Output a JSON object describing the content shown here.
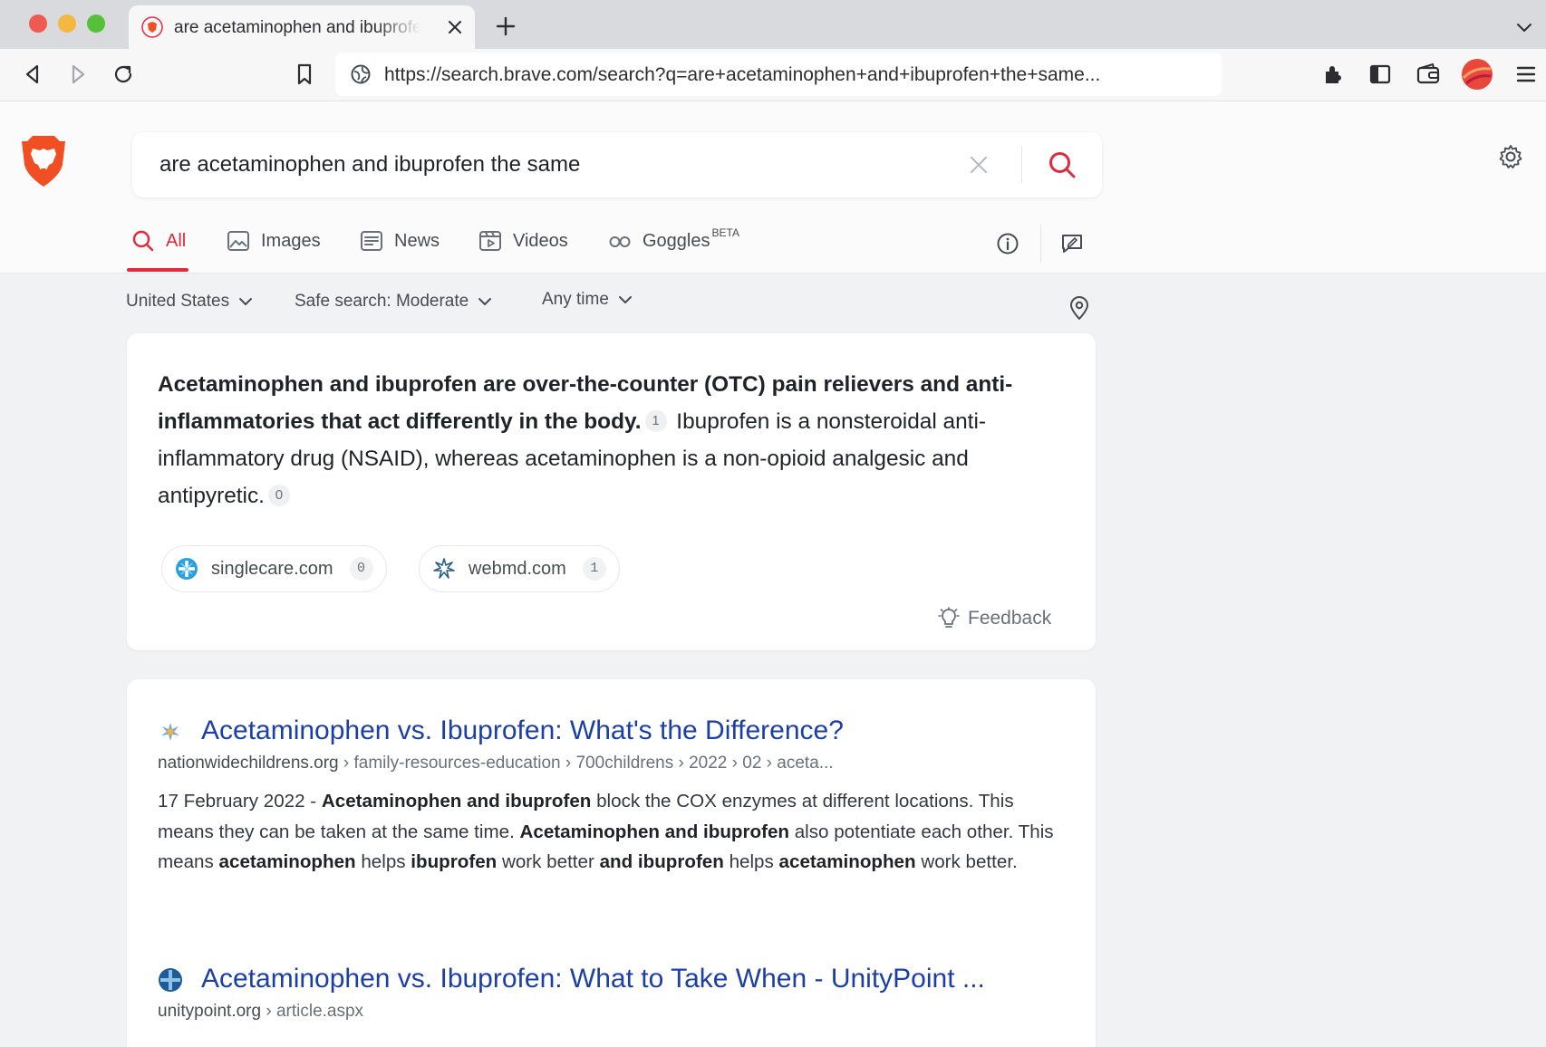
{
  "browser": {
    "tab_title": "are acetaminophen and ibuprofen the same - Brave Search",
    "url": "https://search.brave.com/search?q=are+acetaminophen+and+ibuprofen+the+same..."
  },
  "search": {
    "query": "are acetaminophen and ibuprofen the same"
  },
  "nav": {
    "all": "All",
    "images": "Images",
    "news": "News",
    "videos": "Videos",
    "goggles": "Goggles",
    "beta": "BETA"
  },
  "filters": {
    "country": "United States",
    "safe_search": "Safe search: Moderate",
    "time": "Any time"
  },
  "summary": {
    "bold": "Acetaminophen and ibuprofen are over-the-counter (OTC) pain relievers and anti-inflammatories that act differently in the body.",
    "cite1": "1",
    "text": "Ibuprofen is a nonsteroidal anti-inflammatory drug (NSAID), whereas acetaminophen is a non-opioid analgesic and antipyretic.",
    "cite2": "0",
    "sources": [
      {
        "name": "singlecare.com",
        "count": "0"
      },
      {
        "name": "webmd.com",
        "count": "1"
      }
    ],
    "feedback": "Feedback"
  },
  "results": [
    {
      "title": "Acetaminophen vs. Ibuprofen: What's the Difference?",
      "domain": "nationwidechildrens.org",
      "path": " › family-resources-education › 700childrens › 2022 › 02 › aceta...",
      "desc": [
        {
          "t": "17 February 2022 - ",
          "b": false
        },
        {
          "t": "Acetaminophen and ibuprofen",
          "b": true
        },
        {
          "t": " block the COX enzymes at different locations. This means they can be taken at the same time. ",
          "b": false
        },
        {
          "t": "Acetaminophen and ibuprofen",
          "b": true
        },
        {
          "t": " also potentiate each other. This means ",
          "b": false
        },
        {
          "t": "acetaminophen",
          "b": true
        },
        {
          "t": " helps ",
          "b": false
        },
        {
          "t": "ibuprofen",
          "b": true
        },
        {
          "t": " work better ",
          "b": false
        },
        {
          "t": "and ibuprofen",
          "b": true
        },
        {
          "t": " helps ",
          "b": false
        },
        {
          "t": "acetaminophen",
          "b": true
        },
        {
          "t": " work better.",
          "b": false
        }
      ]
    },
    {
      "title": "Acetaminophen vs. Ibuprofen: What to Take When - UnityPoint ...",
      "domain": "unitypoint.org",
      "path": " › article.aspx"
    }
  ],
  "colors": {
    "accent": "#e2293d",
    "link": "#1c3fa5",
    "brave_orange": "#f04e23"
  }
}
